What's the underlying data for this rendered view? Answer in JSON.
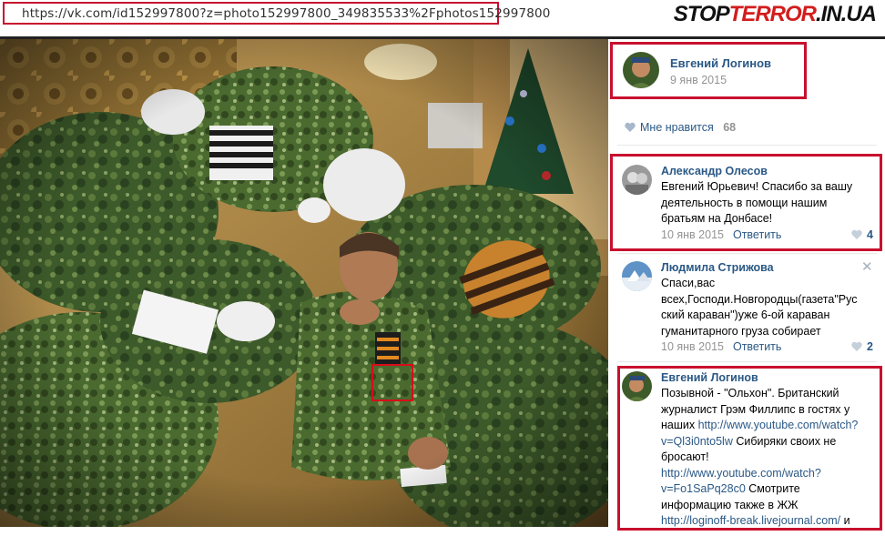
{
  "browser": {
    "url": "https://vk.com/id152997800?z=photo152997800_349835533%2Fphotos152997800"
  },
  "watermark": {
    "part1": "STOP",
    "part2": "TERROR",
    "part3": ".IN.UA"
  },
  "photo": {
    "alt_icon": "photo-image"
  },
  "post": {
    "author": "Евгений Логинов",
    "date": "9 янв 2015",
    "like_label": "Мне нравится",
    "like_count": "68"
  },
  "comments": [
    {
      "author": "Александр Олесов",
      "lines": [
        "Евгений Юрьевич! Спасибо за вашу",
        "деятельность в помощи нашим",
        "братьям на Донбасе!"
      ],
      "date": "10 янв 2015",
      "reply": "Ответить",
      "likes": "4"
    },
    {
      "author": "Людмила Стрижова",
      "lines": [
        "Спаси,вас",
        "всех,Господи.Новгородцы(газета\"Рус",
        "ский караван\")уже 6-ой караван",
        "гуманитарного груза собирает"
      ],
      "date": "10 янв 2015",
      "reply": "Ответить",
      "likes": "2"
    },
    {
      "author": "Евгений Логинов",
      "lines": [
        "Позывной - \"Ольхон\". Британский",
        "журналист Грэм Филлипс в гостях у",
        "наших ",
        "v=Ql3i0nto5lw",
        " Сибиряки своих не",
        "бросают!",
        "http://www.youtube.com/watch?",
        "v=Fo1SaPq28c0",
        " Смотрите",
        "информацию также в ЖЖ",
        "http://loginoff-break.livejournal.com/",
        " и"
      ],
      "link1_part1": "http://www.youtube.com/watch?"
    }
  ],
  "colors": {
    "link": "#2a5885",
    "highlight": "#c8102e",
    "meta": "#939393"
  }
}
